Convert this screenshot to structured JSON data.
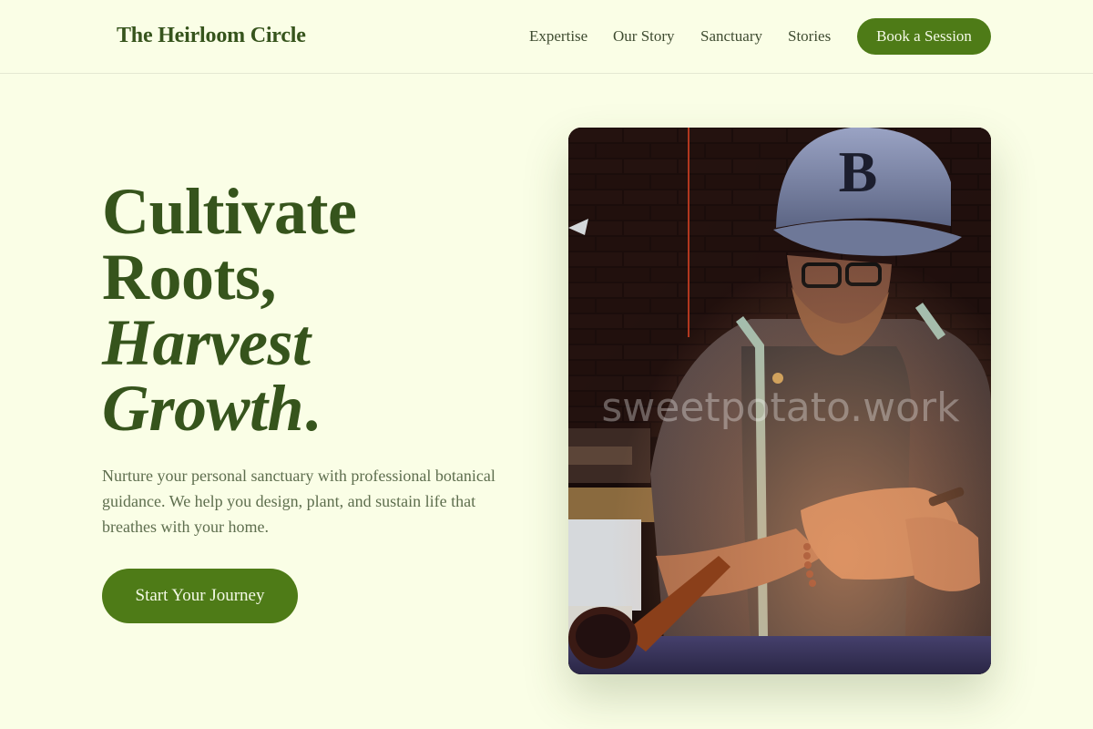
{
  "brand": {
    "name": "The Heirloom Circle"
  },
  "nav": {
    "items": [
      {
        "label": "Expertise"
      },
      {
        "label": "Our Story"
      },
      {
        "label": "Sanctuary"
      },
      {
        "label": "Stories"
      }
    ],
    "cta_label": "Book a Session"
  },
  "hero": {
    "title_line1": "Cultivate",
    "title_line2": "Roots,",
    "title_line3": "Harvest",
    "title_line4": "Growth",
    "title_period": ".",
    "description": "Nurture your personal sanctuary with professional botanical guidance. We help you design, plant, and sustain life that breathes with your home.",
    "cta_label": "Start Your Journey",
    "image_watermark": "sweetpotato.work"
  },
  "colors": {
    "background": "#fafee6",
    "brand_green": "#36541c",
    "button_green": "#4e7b17",
    "body_text": "#5e6e4e"
  }
}
